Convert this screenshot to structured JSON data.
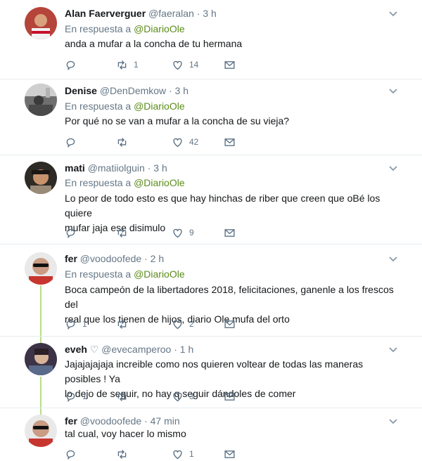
{
  "tweets": [
    {
      "name": "Alan Faerverguer",
      "handle": "@faeralan",
      "time": "3 h",
      "reply_prefix": "En respuesta a",
      "reply_to": "@DiarioOle",
      "lines": [
        "anda a mufar a la concha de tu hermana"
      ],
      "retweets": "1",
      "likes": "14",
      "replies": ""
    },
    {
      "name": "Denise",
      "handle": "@DenDemkow",
      "time": "3 h",
      "reply_prefix": "En respuesta a",
      "reply_to": "@DiarioOle",
      "lines": [
        "Por qué no se van a mufar a la concha de su vieja?"
      ],
      "retweets": "",
      "likes": "42",
      "replies": ""
    },
    {
      "name": "mati",
      "handle": "@matiiolguin",
      "time": "3 h",
      "reply_prefix": "En respuesta a",
      "reply_to": "@DiarioOle",
      "lines": [
        "Lo peor de todo esto es que hay hinchas de riber que creen que oBé los quiere",
        "mufar jaja ese disimulo"
      ],
      "retweets": "",
      "likes": "9",
      "replies": ""
    },
    {
      "name": "fer",
      "handle": "@voodoofede",
      "time": "2 h",
      "reply_prefix": "En respuesta a",
      "reply_to": "@DiarioOle",
      "lines": [
        "Boca campeón de la libertadores 2018, felicitaciones, ganenle a los frescos del",
        "real que los tienen de hijos, diario Ole mufa del orto"
      ],
      "retweets": "",
      "likes": "2",
      "replies": "1"
    },
    {
      "name": "eveh",
      "name_suffix": "♡",
      "handle": "@evecamperoo",
      "time": "1 h",
      "lines": [
        "Jajajajajaja increible como nos quieren voltear de todas las maneras posibles ! Ya",
        "lo dejo de seguir, no hay q seguir dándoles de comer"
      ],
      "retweets": "",
      "likes": "3",
      "replies": "1"
    },
    {
      "name": "fer",
      "handle": "@voodoofede",
      "time": "47 min",
      "lines": [
        "tal cual, voy hacer lo mismo"
      ],
      "retweets": "",
      "likes": "1",
      "replies": ""
    }
  ],
  "separator_dot": "·",
  "icons": {
    "reply": "reply-icon",
    "retweet": "retweet-icon",
    "like": "heart-icon",
    "dm": "envelope-icon",
    "more": "chevron-down-icon"
  },
  "colors": {
    "mention": "#5b8c1a",
    "thread_line": "#b8dd88",
    "secondary_text": "#657786"
  }
}
